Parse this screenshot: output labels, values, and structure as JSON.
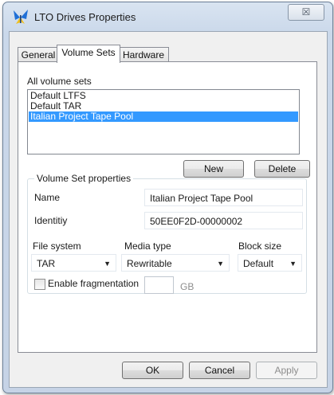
{
  "window": {
    "title": "LTO Drives Properties",
    "close_glyph": "☒",
    "app_icon": "butterfly-icon",
    "icon_colors": [
      "#1f6fd6",
      "#f0c020"
    ]
  },
  "tabs": [
    {
      "label": "General",
      "active": false
    },
    {
      "label": "Volume Sets",
      "active": true
    },
    {
      "label": "Hardware",
      "active": false
    }
  ],
  "volume_sets": {
    "label": "All volume sets",
    "items": [
      "Default LTFS",
      "Default TAR",
      "Italian Project Tape Pool"
    ],
    "selected_index": 2,
    "new_label": "New",
    "delete_label": "Delete"
  },
  "properties": {
    "group_label": "Volume Set properties",
    "name_label": "Name",
    "name_value": "Italian Project Tape Pool",
    "identity_label": "Identitiy",
    "identity_value": "50EE0F2D-00000002",
    "file_system_label": "File system",
    "file_system_value": "TAR",
    "media_type_label": "Media type",
    "media_type_value": "Rewritable",
    "block_size_label": "Block size",
    "block_size_value": "Default",
    "fragmentation_label": "Enable fragmentation",
    "fragmentation_checked": false,
    "fragmentation_size_value": "",
    "unit_label": "GB"
  },
  "footer": {
    "ok_label": "OK",
    "cancel_label": "Cancel",
    "apply_label": "Apply"
  },
  "colors": {
    "selection": "#3399ff",
    "accent": "#1f6fd6"
  }
}
